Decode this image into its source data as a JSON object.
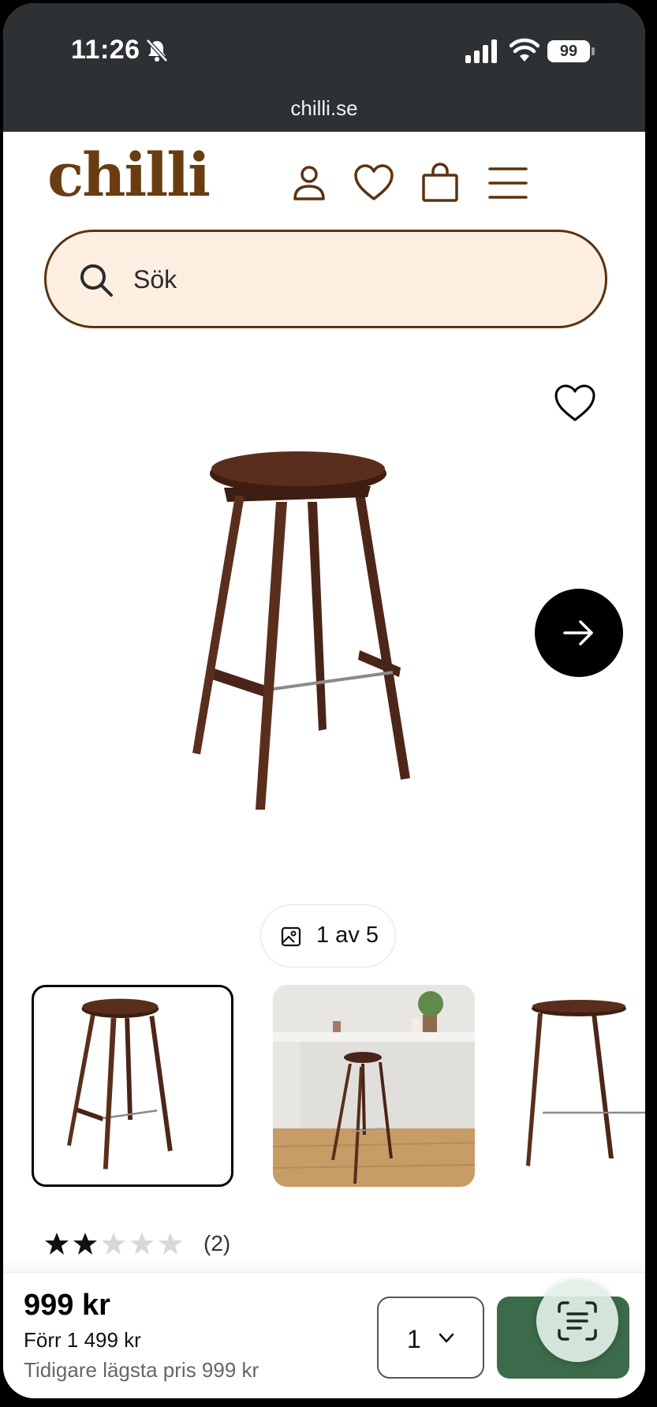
{
  "status_bar": {
    "time": "11:26",
    "battery": "99"
  },
  "browser": {
    "url": "chilli.se"
  },
  "header": {
    "logo": "chilli"
  },
  "search": {
    "placeholder": "Sök"
  },
  "gallery": {
    "counter": "1 av 5"
  },
  "rating": {
    "stars": 2,
    "max_stars": 5,
    "count": "(2)"
  },
  "purchase": {
    "price": "999 kr",
    "previous_price": "Förr 1 499 kr",
    "lowest_price": "Tidigare lägsta pris 999 kr",
    "quantity": "1"
  },
  "colors": {
    "brand": "#6a3c11",
    "search_bg": "#fdeee2",
    "buy_button": "#3c6b4b",
    "topbar": "#2d3133"
  }
}
